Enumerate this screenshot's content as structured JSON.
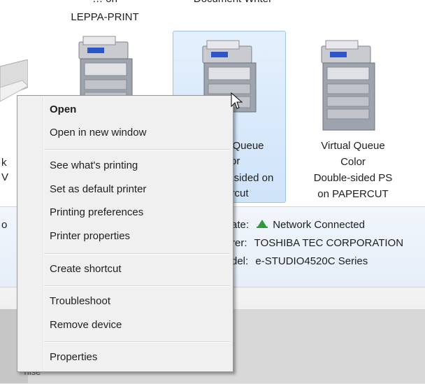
{
  "window": {
    "devices": [
      {
        "label_lines": [
          "LEPPA-PRINT"
        ],
        "top_cut_line": "… on",
        "selected": false
      },
      {
        "label_lines": [
          "Queue",
          "lor",
          "sided on",
          "rcut"
        ],
        "top_cut_line": "Document Writer",
        "selected": true
      },
      {
        "label_lines": [
          "Virtual Queue",
          "Color",
          "Double-sided PS",
          "on PAPERCUT"
        ],
        "selected": false
      }
    ],
    "left_cut_labels": [
      "k",
      "V"
    ],
    "details": {
      "left_cut": "o",
      "state_label": "ate:",
      "state_value": "Network Connected",
      "manufacturer_label": "rer:",
      "manufacturer_value": "TOSHIBA TEC CORPORATION",
      "model_label": "del:",
      "model_value": "e-STUDIO4520C Series"
    },
    "lower_cut_text": "'nise",
    "colors": {
      "accent_selection": "#cfe3f9",
      "network_icon": "#2e9a3a"
    }
  },
  "context_menu": {
    "groups": [
      [
        "Open",
        "Open in new window"
      ],
      [
        "See what's printing",
        "Set as default printer",
        "Printing preferences",
        "Printer properties"
      ],
      [
        "Create shortcut"
      ],
      [
        "Troubleshoot",
        "Remove device"
      ],
      [
        "Properties"
      ]
    ],
    "default_item": "Open"
  }
}
